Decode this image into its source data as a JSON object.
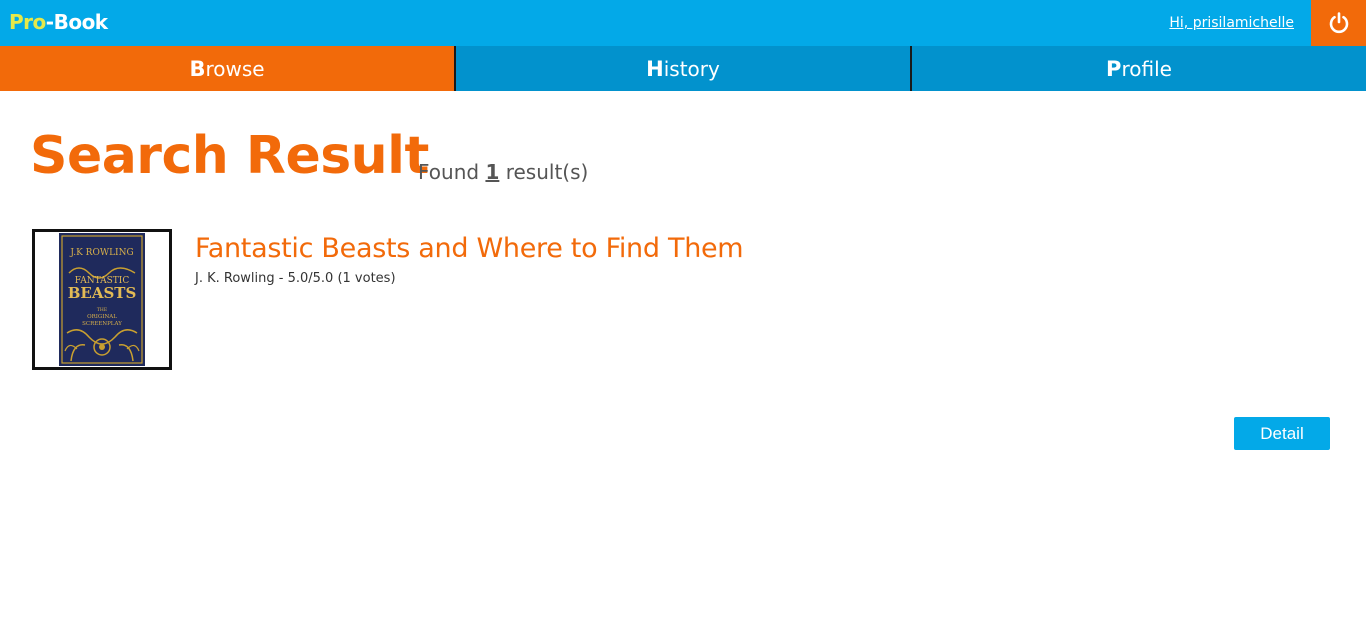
{
  "header": {
    "logo_pro": "Pro",
    "logo_dash": "-",
    "logo_book": "Book",
    "greeting": "Hi, prisilamichelle",
    "logout_icon": "power-icon"
  },
  "nav": {
    "tabs": [
      {
        "first": "B",
        "rest": "rowse",
        "active": true
      },
      {
        "first": "H",
        "rest": "istory",
        "active": false
      },
      {
        "first": "P",
        "rest": "rofile",
        "active": false
      }
    ]
  },
  "search": {
    "title": "Search Result",
    "found_prefix": "Found",
    "found_count": "1",
    "found_suffix": "result(s)"
  },
  "results": [
    {
      "title": "Fantastic Beasts and Where to Find Them",
      "meta": "J. K. Rowling - 5.0/5.0 (1 votes)",
      "cover": {
        "author": "J.K ROWLING",
        "title_line1": "FANTASTIC",
        "title_line2": "BEASTS",
        "sub_line1": "THE",
        "sub_line2": "ORIGINAL",
        "sub_line3": "SCREENPLAY"
      },
      "detail_label": "Detail"
    }
  ],
  "colors": {
    "topbar": "#03a9e8",
    "accent": "#f26a0a",
    "nav_inactive": "#0292cd",
    "logo_pro": "#e6e84a"
  }
}
